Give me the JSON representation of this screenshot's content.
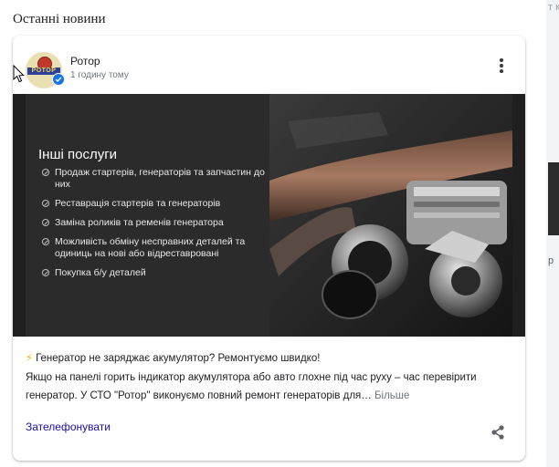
{
  "section_title": "Останні новини",
  "post": {
    "author": "Ротор",
    "avatar_text": "РОТОР",
    "time": "1 годину тому",
    "image": {
      "title": "Інші послуги",
      "items": [
        "Продаж стартерів, генераторів та запчастин до них",
        "Реставрація стартерів та генераторів",
        "Заміна роликів та ременів генератора",
        "Можливість обміну несправних деталей та одиниць на нові або відреставровані",
        "Покупка б/у деталей"
      ]
    },
    "headline": "Генератор не заряджає акумулятор? Ремонтуємо швидко!",
    "body": "Якщо на панелі горить індикатор акумулятора або авто глохне під час руху – час перевірити генератор. У СТО \"Ротор\" виконуємо повний ремонт генераторів для…",
    "more_label": "Більше",
    "call_label": "Зателефонувати"
  },
  "side_peek": {
    "top_text": "т к ші",
    "bottom_text": "р"
  },
  "icons": {
    "cursor": "mouse-cursor-icon",
    "verified": "verified-check-icon",
    "more": "more-vert-icon",
    "bolt": "lightning-bolt-icon",
    "share": "share-icon",
    "check": "check-circle-icon"
  },
  "colors": {
    "link": "#1a0dab",
    "verified": "#1a73e8",
    "bolt": "#f9ab00",
    "muted": "#70757a"
  }
}
